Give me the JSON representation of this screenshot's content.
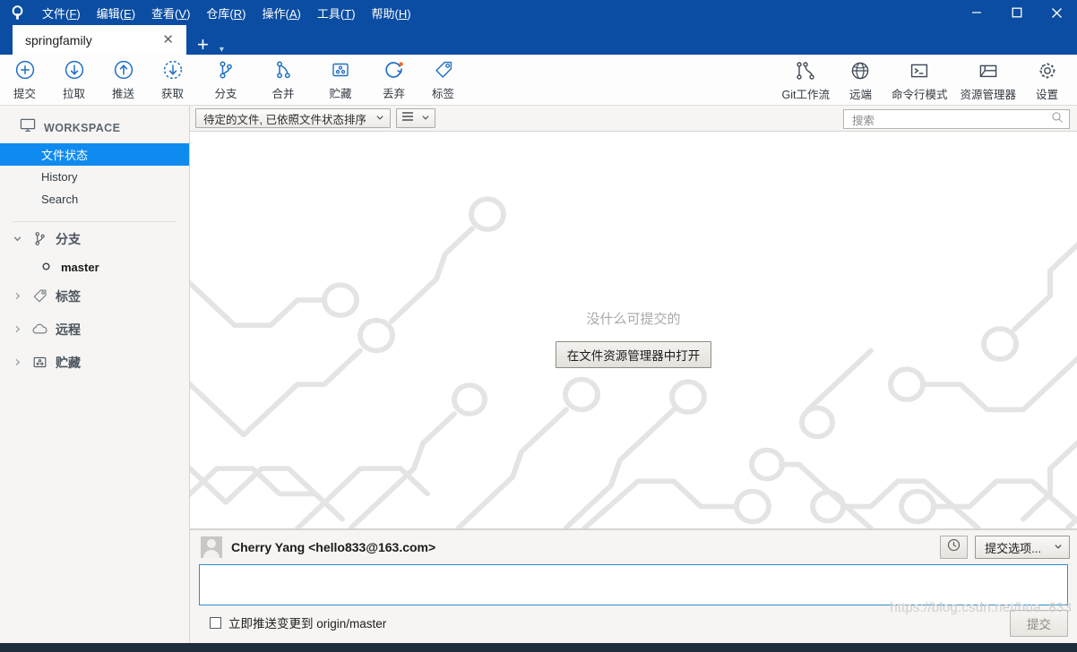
{
  "window": {
    "app_logo": "sourcetree-logo-icon",
    "minimize": "—",
    "maximize": "□",
    "close": "✕",
    "hamburger": "hamburger-icon"
  },
  "menubar": {
    "items": [
      {
        "text": "文件",
        "mnemonic": "F"
      },
      {
        "text": "编辑",
        "mnemonic": "E"
      },
      {
        "text": "查看",
        "mnemonic": "V"
      },
      {
        "text": "仓库",
        "mnemonic": "R"
      },
      {
        "text": "操作",
        "mnemonic": "A"
      },
      {
        "text": "工具",
        "mnemonic": "T"
      },
      {
        "text": "帮助",
        "mnemonic": "H"
      }
    ]
  },
  "tabs": {
    "active_tab_label": "springfamily",
    "close_glyph": "✕",
    "add_glyph": "+",
    "add_caret_glyph": "▾"
  },
  "toolbar": {
    "left_buttons": [
      {
        "label": "提交",
        "icon": "commit-plus-icon"
      },
      {
        "label": "拉取",
        "icon": "pull-down-arrow-icon"
      },
      {
        "label": "推送",
        "icon": "push-up-arrow-icon"
      },
      {
        "label": "获取",
        "icon": "fetch-dashed-arrow-icon"
      },
      {
        "label": "分支",
        "icon": "branch-icon"
      },
      {
        "label": "合并",
        "icon": "merge-icon"
      },
      {
        "label": "贮藏",
        "icon": "stash-box-icon"
      },
      {
        "label": "丢弃",
        "icon": "discard-reset-icon"
      },
      {
        "label": "标签",
        "icon": "tag-icon"
      }
    ],
    "right_buttons": [
      {
        "label": "Git工作流",
        "icon": "gitflow-icon"
      },
      {
        "label": "远端",
        "icon": "globe-icon"
      },
      {
        "label": "命令行模式",
        "icon": "terminal-icon"
      },
      {
        "label": "资源管理器",
        "icon": "explorer-folder-icon"
      },
      {
        "label": "设置",
        "icon": "gear-icon"
      }
    ]
  },
  "sidebar": {
    "workspace_label": "WORKSPACE",
    "workspace_icon": "monitor-icon",
    "nav_items": [
      {
        "label": "文件状态",
        "active": true
      },
      {
        "label": "History",
        "active": false
      },
      {
        "label": "Search",
        "active": false
      }
    ],
    "sections": [
      {
        "label": "分支",
        "icon": "branch-icon",
        "expanded": true,
        "caret": "⌄"
      },
      {
        "label": "标签",
        "icon": "tag-icon",
        "expanded": false,
        "caret": "›"
      },
      {
        "label": "远程",
        "icon": "cloud-icon",
        "expanded": false,
        "caret": "›"
      },
      {
        "label": "贮藏",
        "icon": "stash-box-icon",
        "expanded": false,
        "caret": "›"
      }
    ],
    "branches": [
      {
        "label": "master",
        "icon": "branch-node-icon",
        "current": true
      }
    ]
  },
  "filterbar": {
    "sort_combo_value": "待定的文件, 已依照文件状态排序",
    "sort_combo_caret": "⌄",
    "view_mode_icon": "list-lines-icon",
    "view_mode_caret": "⌄",
    "search_placeholder": "搜索",
    "search_value": "",
    "search_icon": "search-icon"
  },
  "main": {
    "empty_message": "没什么可提交的",
    "open_in_explorer_label": "在文件资源管理器中打开",
    "background_pattern": "circuit-board-pattern"
  },
  "commit_pane": {
    "author": "Cherry Yang <hello833@163.com>",
    "avatar_icon": "user-avatar",
    "history_icon": "clock-icon",
    "commit_options_label": "提交选项...",
    "commit_options_caret": "⌄",
    "message_value": "",
    "message_placeholder": "",
    "push_checkbox_checked": false,
    "push_checkbox_label_cn": "立即推送变更到",
    "push_checkbox_target": "origin/master",
    "commit_button_label": "提交"
  },
  "watermark": {
    "text": "https://blog.csdn.net/hua..833"
  },
  "colors": {
    "titlebar_blue": "#0b4da2",
    "accent_blue": "#0f8bf0",
    "icon_blue": "#1f6fc4",
    "sidebar_bg": "#f6f5f3",
    "focus_border": "#2e8fce",
    "discard_dot_orange": "#f26b1d"
  }
}
